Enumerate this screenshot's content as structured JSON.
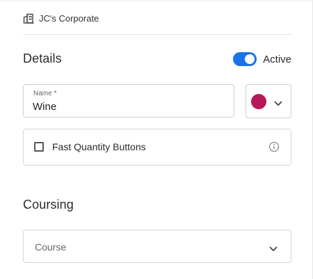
{
  "location": {
    "name": "JC's Corporate",
    "icon": "building-icon"
  },
  "details": {
    "title": "Details",
    "active_toggle": {
      "label": "Active",
      "on": true,
      "color": "#1a73e8"
    },
    "name_field": {
      "label": "Name *",
      "value": "Wine"
    },
    "color_picker": {
      "selected_color": "#b5195b",
      "icon": "chevron-down-icon"
    },
    "fast_quantity": {
      "label": "Fast Quantity Buttons",
      "checked": false,
      "icon": "info-icon"
    }
  },
  "coursing": {
    "title": "Coursing",
    "course_select": {
      "placeholder": "Course",
      "icon": "chevron-down-icon"
    }
  }
}
